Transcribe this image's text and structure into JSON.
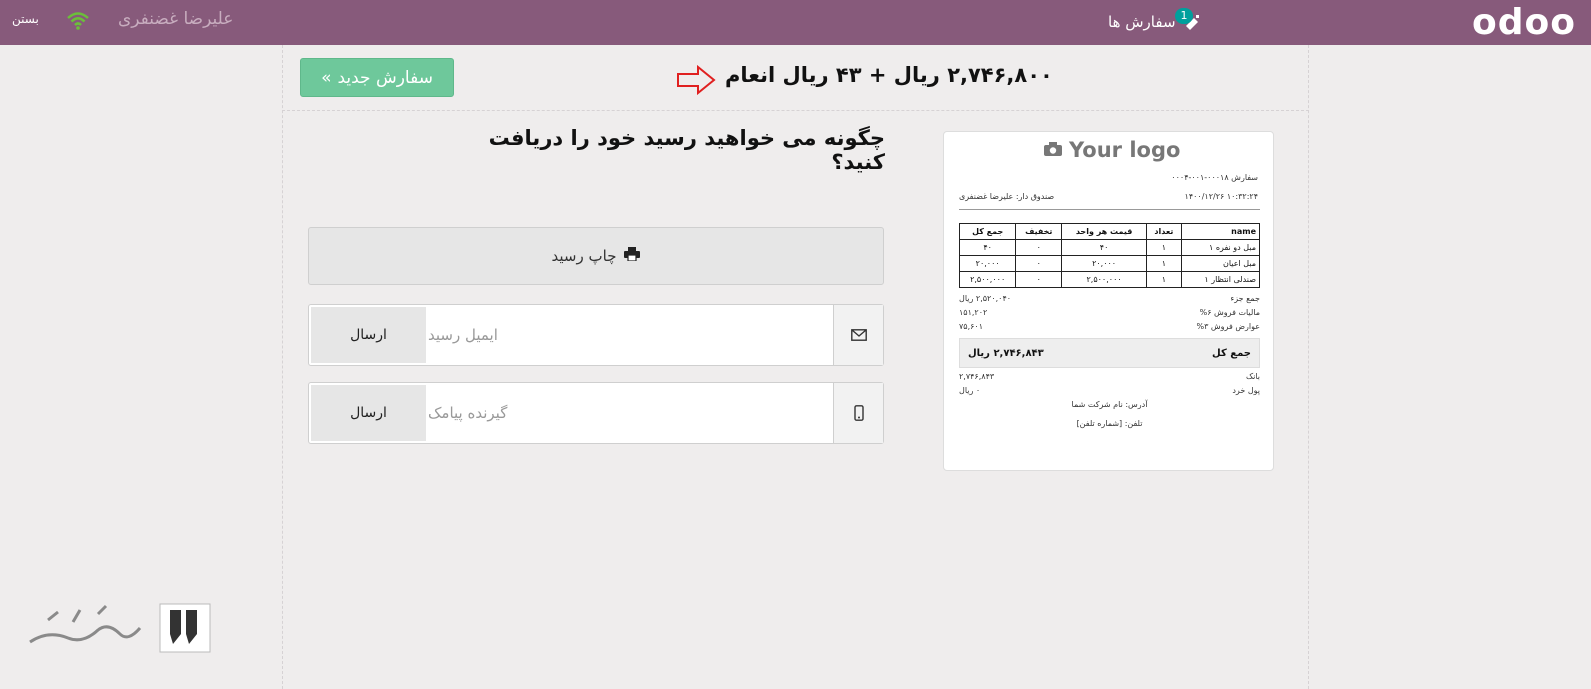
{
  "topbar": {
    "logo": "odoo",
    "orders_label": "سفارش ها",
    "orders_badge": "1",
    "cashier_name": "علیرضا غضنفری",
    "close_label": "بستن"
  },
  "payment": {
    "new_order_label": "سفارش جدید",
    "total_text": "۲,۷۴۶,۸۰۰ ریال + ۴۳ ریال انعام",
    "question": "چگونه می خواهید رسید خود را دریافت کنید؟",
    "print_label": "چاپ رسید",
    "email_placeholder": "ایمیل رسید",
    "sms_placeholder": "گیرنده پیامک",
    "send_label": "ارسال"
  },
  "receipt": {
    "logo_text": "Your logo",
    "order_ref": "سفارش ۰۰۰۱۸-۰۰۱-۰۰۰۴",
    "datetime": "۱۴۰۰/۱۲/۲۶ ۱۰:۳۲:۲۴",
    "cashier": "صندوق دار: علیرضا غضنفری",
    "headers": [
      "name",
      "تعداد",
      "قیمت هر واحد",
      "تخفیف",
      "جمع کل"
    ],
    "rows": [
      [
        "مبل دو نفره ۱",
        "۱",
        "۴۰",
        "۰",
        "۴۰"
      ],
      [
        "مبل اعیان",
        "۱",
        "۲۰,۰۰۰",
        "۰",
        "۲۰,۰۰۰"
      ],
      [
        "صندلی انتظار ۱",
        "۱",
        "۲,۵۰۰,۰۰۰",
        "۰",
        "۲,۵۰۰,۰۰۰"
      ]
    ],
    "subtotal_label": "جمع جزء",
    "subtotal_value": "۲,۵۲۰,۰۴۰ ریال",
    "tax1_label": "مالیات فروش ۶%",
    "tax1_value": "۱۵۱,۲۰۲",
    "tax2_label": "عوارض فروش ۳%",
    "tax2_value": "۷۵,۶۰۱",
    "total_label": "جمع کل",
    "total_value": "۲,۷۴۶,۸۴۳ ریال",
    "bank_label": "بانک",
    "bank_value": "۲,۷۴۶,۸۴۳",
    "change_label": "پول خرد",
    "change_value": "۰ ریال",
    "address": "آدرس: نام شرکت شما",
    "phone": "تلفن: [شماره تلفن]"
  },
  "colors": {
    "topbar": "#875a7b",
    "accent_green": "#6ec89b",
    "wifi_green": "#6bbf3a",
    "arrow_red": "#e02020"
  }
}
